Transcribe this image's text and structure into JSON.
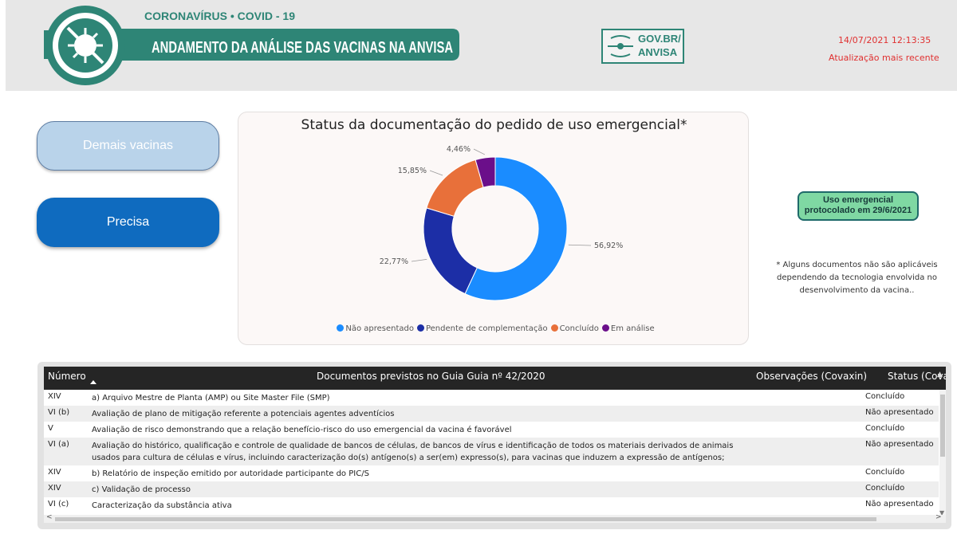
{
  "header": {
    "banner_top": "CORONAVÍRUS • COVID - 19",
    "banner_title": "ANDAMENTO DA ANÁLISE DAS VACINAS NA ANVISA",
    "gov_logo_line1": "GOV.BR/",
    "gov_logo_line2": "ANVISA",
    "datetime": "14/07/2021 12:13:35",
    "updated_label": "Atualização mais recente"
  },
  "nav": {
    "demais_label": "Demais vacinas",
    "precisa_label": "Precisa"
  },
  "badge": {
    "line1": "Uso emergencial",
    "line2": "protocolado em 29/6/2021"
  },
  "footnote": "* Alguns documentos não são aplicáveis dependendo da tecnologia envolvida no desenvolvimento da vacina..",
  "colors": {
    "nao_apresentado": "#1a8cff",
    "pendente": "#1c2ea6",
    "concluido": "#e8703a",
    "em_analise": "#6b0f8a",
    "teal": "#2e8576",
    "alert_red": "#e03030"
  },
  "chart_data": {
    "type": "pie",
    "donut": true,
    "title": "Status da documentação do pedido de uso emergencial*",
    "categories": [
      "Não apresentado",
      "Pendente de complementação",
      "Concluído",
      "Em análise"
    ],
    "values": [
      56.92,
      22.77,
      15.85,
      4.46
    ],
    "value_labels": [
      "56,92%",
      "22,77%",
      "15,85%",
      "4,46%"
    ],
    "legend_position": "bottom"
  },
  "table": {
    "headers": {
      "numero": "Número",
      "documentos": "Documentos previstos no Guia Guia nº 42/2020",
      "observacoes": "Observações (Covaxin)",
      "status": "Status (Cova"
    },
    "rows": [
      {
        "num": "XIV",
        "doc": "a) Arquivo Mestre de Planta (AMP) ou Site Master File (SMP)",
        "status": "Concluído"
      },
      {
        "num": "VI (b)",
        "doc": "Avaliação de plano de mitigação referente a potenciais agentes adventícios",
        "status": "Não apresentado"
      },
      {
        "num": "V",
        "doc": "Avaliação de risco demonstrando que a relação benefício-risco do uso emergencial da vacina é favorável",
        "status": "Concluído"
      },
      {
        "num": "VI (a)",
        "doc": "Avaliação do histórico, qualificação e controle de qualidade de bancos de células, de bancos de vírus e identificação de todos os materiais derivados de animais usados para cultura de células e vírus, incluindo caracterização do(s) antígeno(s) a ser(em) expresso(s), para vacinas que induzem a expressão de antígenos;",
        "status": "Não apresentado"
      },
      {
        "num": "XIV",
        "doc": "b) Relatório de inspeção emitido por autoridade participante do PIC/S",
        "status": "Concluído"
      },
      {
        "num": "XIV",
        "doc": "c) Validação de processo",
        "status": "Concluído"
      },
      {
        "num": "VI (c)",
        "doc": "Caracterização da substância ativa",
        "status": "Não apresentado"
      }
    ]
  }
}
